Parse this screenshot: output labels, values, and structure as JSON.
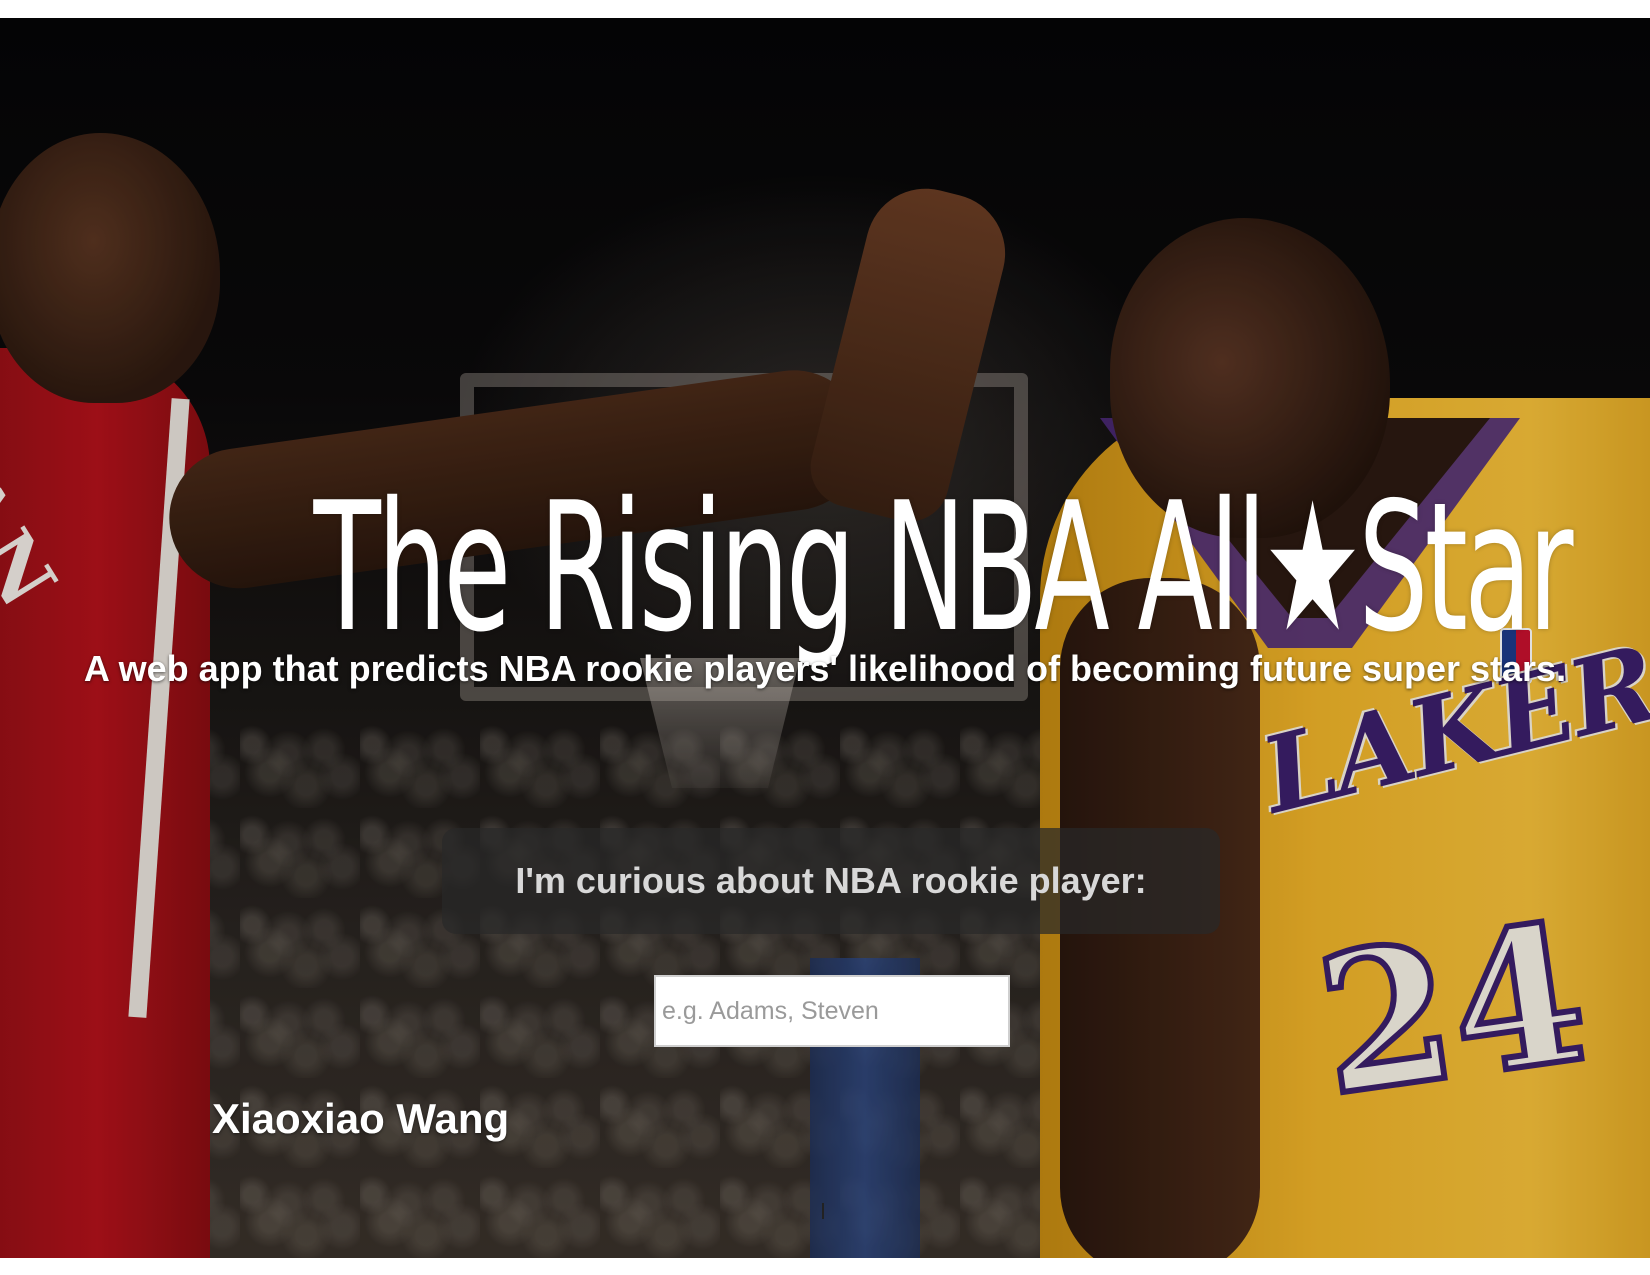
{
  "hero": {
    "title": "The Rising NBA All★Star",
    "subtitle": "A web app that predicts NBA rookie players' likelihood of becoming future super stars.",
    "background_image": "basketball-players-photo"
  },
  "prompt": {
    "label": "I'm curious about NBA rookie player:"
  },
  "search": {
    "value": "",
    "placeholder": "e.g. Adams, Steven"
  },
  "footer": {
    "author": "Xiaoxiao Wang"
  },
  "photo_text": {
    "left_jersey": "AN",
    "right_jersey_team": "LAKERS",
    "right_jersey_number": "24"
  },
  "colors": {
    "title_text": "#ffffff",
    "prompt_bg": "rgba(40,40,40,0.72)",
    "bulls_red": "#b3121b",
    "lakers_gold": "#f0b429",
    "lakers_purple": "#3c1f6b"
  }
}
